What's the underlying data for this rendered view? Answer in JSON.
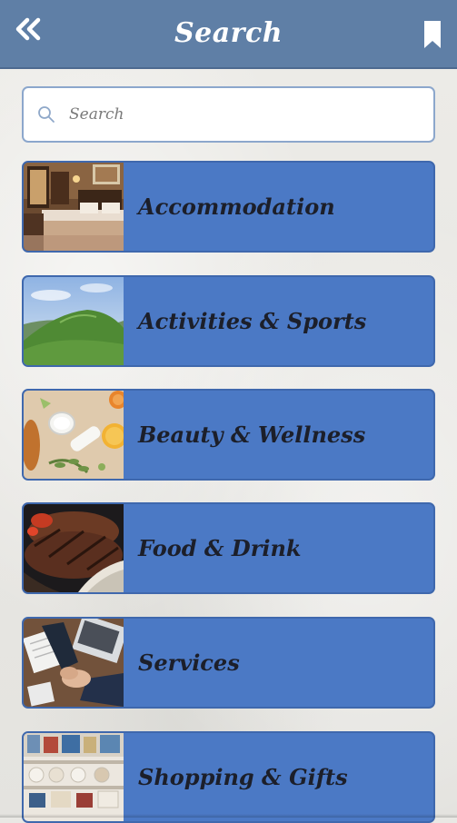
{
  "header": {
    "title": "Search",
    "back_icon": "double-chevron-left-icon",
    "bookmark_icon": "bookmark-icon"
  },
  "search": {
    "placeholder": "Search",
    "value": "",
    "icon": "search-icon"
  },
  "categories": [
    {
      "label": "Accommodation",
      "image": "hotel-room-image"
    },
    {
      "label": "Activities & Sports",
      "image": "green-hill-image"
    },
    {
      "label": "Beauty & Wellness",
      "image": "spa-products-image"
    },
    {
      "label": "Food & Drink",
      "image": "grilled-steak-image"
    },
    {
      "label": "Services",
      "image": "business-handshake-image"
    },
    {
      "label": "Shopping & Gifts",
      "image": "gift-shop-image"
    }
  ],
  "colors": {
    "header_bg": "#5f7fa6",
    "card_bg": "#4b79c5",
    "card_text": "#1c1f2a",
    "search_border": "#8ca7cc"
  }
}
